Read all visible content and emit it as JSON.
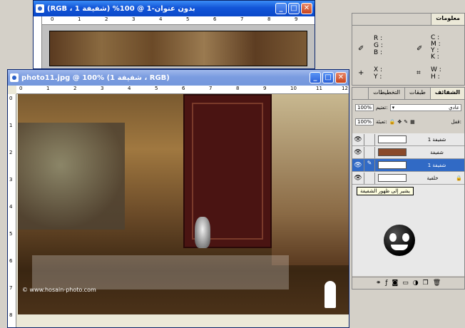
{
  "doc_top": {
    "title": "بدون عنوان-1 @ 100% (شفيفة 1 ، RGB)",
    "ruler_marks": [
      "0",
      "1",
      "2",
      "3",
      "4",
      "5",
      "6",
      "7",
      "8",
      "9"
    ]
  },
  "doc_main": {
    "title": "photo11.jpg @ 100% (شفيفة 1 ، RGB)",
    "ruler_marks": [
      "0",
      "1",
      "2",
      "3",
      "4",
      "5",
      "6",
      "7",
      "8",
      "9",
      "10",
      "11",
      "12"
    ],
    "ruler_v_marks": [
      "0",
      "1",
      "2",
      "3",
      "4",
      "5",
      "6",
      "7",
      "8"
    ],
    "watermark": "© www.hosain-photo.com"
  },
  "info_panel": {
    "tab": "معلومات",
    "rgb_labels": [
      "R :",
      "G :",
      "B :"
    ],
    "cmyk_labels": [
      "C :",
      "M :",
      "Y :",
      "K :"
    ],
    "xy_labels": [
      "X :",
      "Y :"
    ],
    "wh_labels": [
      "W :",
      "H :"
    ]
  },
  "layers_panel": {
    "tabs": [
      "الشفائف",
      "طبقات",
      "التخطيطات"
    ],
    "blend_mode": "عادي",
    "opacity_label": "تعتيم:",
    "opacity_value": "100%",
    "lock_label": "قفل:",
    "fill_label": "تعبئة:",
    "fill_value": "100%",
    "layers": [
      {
        "name": "شفيفة 1",
        "color": "#ffffff"
      },
      {
        "name": "شفيفة",
        "color": "#8a4a2a"
      },
      {
        "name": "شفيفة 1",
        "color": "#ffffff"
      },
      {
        "name": "خلفية",
        "color": "#ffffff"
      }
    ],
    "tooltip": "يشير إلى ظهور الشفيفة"
  },
  "colors": {
    "title_active": "#1255d8",
    "selection": "#316ac5"
  }
}
